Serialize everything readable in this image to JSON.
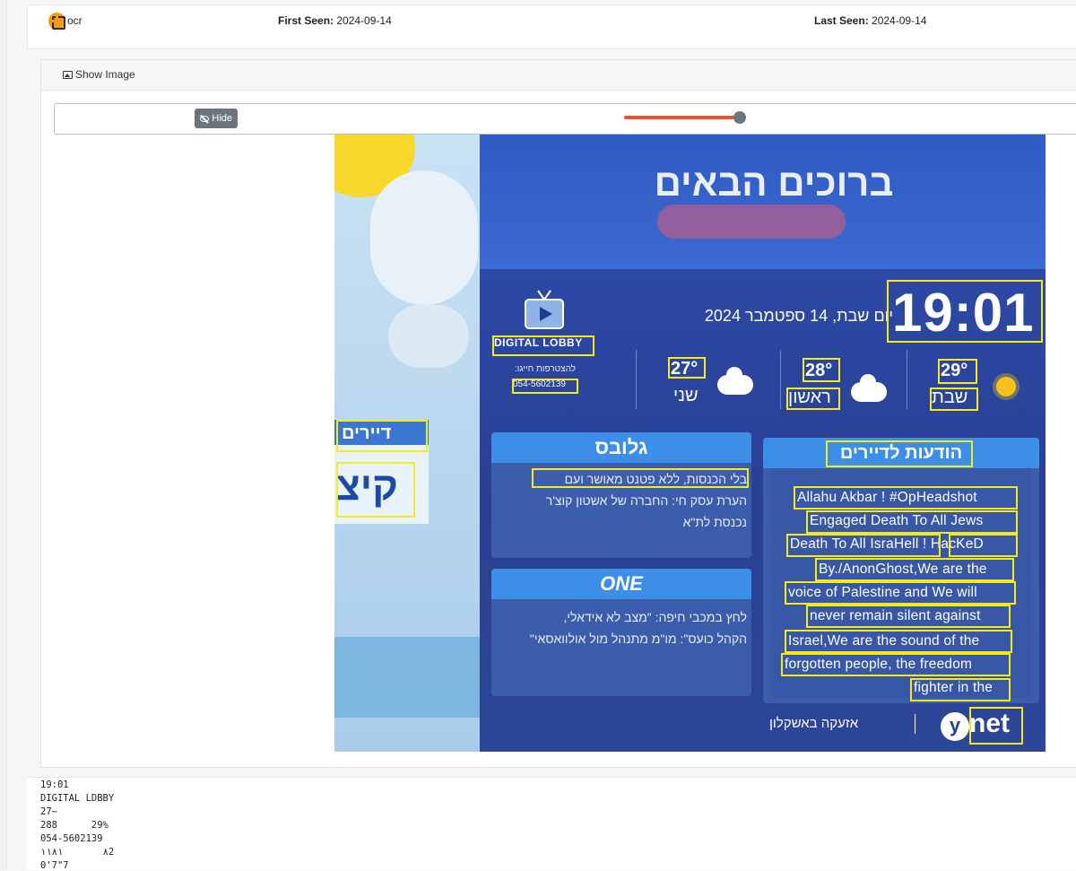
{
  "header": {
    "source_label": "ocr",
    "first_seen_label": "First Seen:",
    "first_seen_value": "2024-09-14",
    "last_seen_label": "Last Seen:",
    "last_seen_value": "2024-09-14"
  },
  "panel": {
    "show_image_label": "Show Image",
    "hide_label": "Hide",
    "slider_value": 1.0
  },
  "screenshot": {
    "welcome": "ברוכים הבאים",
    "clock": "19:01",
    "date_line": "יום שבת, 14 ספטמבר 2024",
    "lobby_label": "DIGITAL LOBBY",
    "join_text": "להצטרפות חייגו:",
    "phone": "054-5602139",
    "weather": [
      {
        "temp": "29°",
        "day": "שבת",
        "icon": "sun-icon"
      },
      {
        "temp": "28°",
        "day": "ראשון",
        "icon": "cloud-icon"
      },
      {
        "temp": "27°",
        "day": "שני",
        "icon": "cloud-icon"
      }
    ],
    "tenants_word": "דיירים",
    "tenants_big": "קיצ",
    "notices_title": "הודעות לדיירים",
    "globes_title": "גלובס",
    "globes_lines": [
      "בלי הכנסות, ללא פטנט מאושר ועם",
      "הערת עסק חי: החברה של אשטון קוצ'ר",
      "נכנסת לת\"א"
    ],
    "one_title": "ONE",
    "one_lines": [
      "לחץ במכבי חיפה: \"מצב לא אידאלי,",
      "הקהל כועס\": מו\"מ מתנהל מול אולוואסאי\""
    ],
    "messages": [
      "Allahu Akbar ! #OpHeadshot",
      "Engaged Death To All Jews",
      "Death To All IsraHell ! HacKeD",
      "By./AnonGhost,We are the",
      "voice of Palestine and We will",
      "never remain silent against",
      "Israel,We are the sound of the",
      "forgotten people, the freedom",
      "fighter in the"
    ],
    "footer_text": "אזעקה באשקלון",
    "brand_y": "y",
    "brand_net": "net"
  },
  "ocr_output": {
    "lines": [
      "19:01",
      "DIGITAL LDBBY",
      "27~",
      "288      29%",
      "054-5602139",
      "٨       ١١٨١2",
      "0'7\"7"
    ]
  },
  "colors": {
    "accent": "#e8562a",
    "badge": "#f39c12",
    "highlight": "#f5ea1a",
    "button": "#6c757d"
  }
}
